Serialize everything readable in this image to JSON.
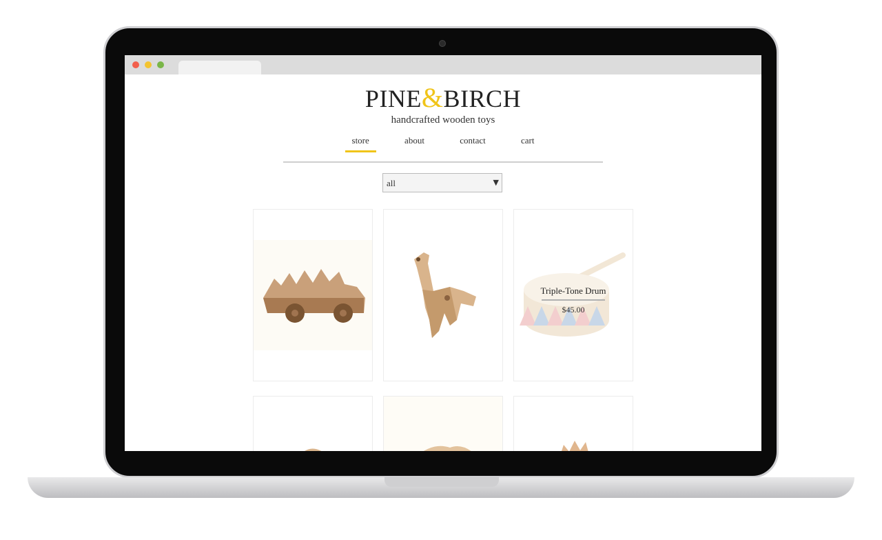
{
  "site": {
    "logo_left": "PINE",
    "logo_amp": "&",
    "logo_right": "BIRCH",
    "tagline": "handcrafted wooden toys"
  },
  "nav": {
    "items": [
      "store",
      "about",
      "contact",
      "cart"
    ],
    "active": "store"
  },
  "filter": {
    "selected": "all"
  },
  "products": [
    {
      "image": "wooden-car-image"
    },
    {
      "image": "wooden-giraffe-image"
    },
    {
      "image": "wooden-drum-image",
      "title": "Triple-Tone Drum",
      "price": "$45.00"
    }
  ],
  "colors": {
    "accent": "#f0c419",
    "text": "#222222",
    "rule": "#cfcfcf"
  }
}
